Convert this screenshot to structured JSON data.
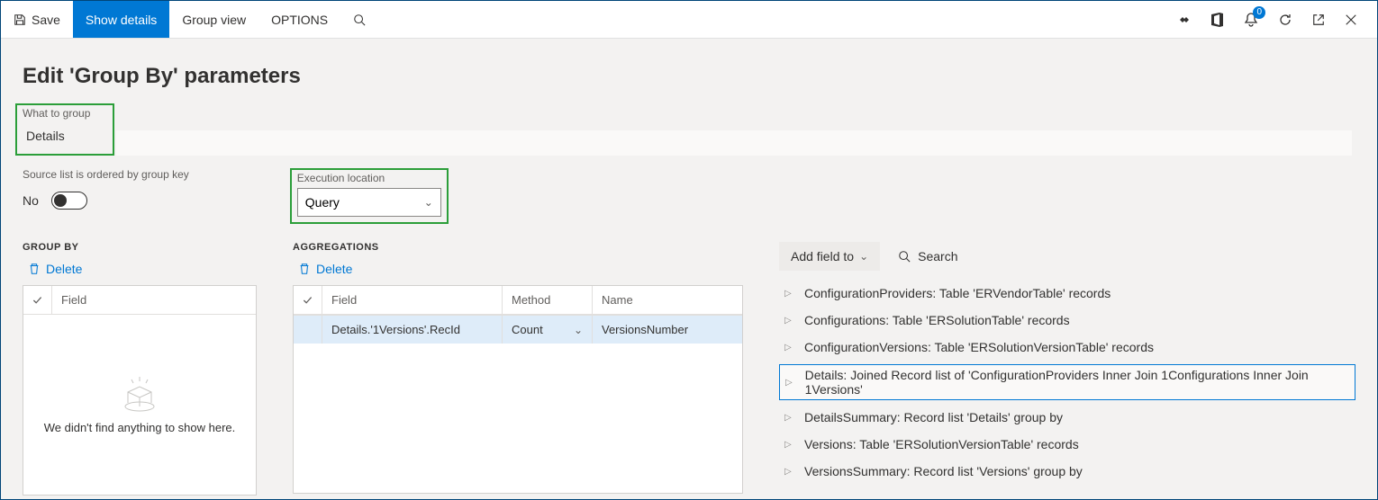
{
  "toolbar": {
    "save": "Save",
    "show_details": "Show details",
    "group_view": "Group view",
    "options": "OPTIONS",
    "badge_count": "0"
  },
  "page": {
    "title": "Edit 'Group By' parameters",
    "what_to_group_label": "What to group",
    "what_to_group_value": "Details",
    "ordered_label": "Source list is ordered by group key",
    "ordered_value": "No",
    "exec_label": "Execution location",
    "exec_value": "Query"
  },
  "groupby": {
    "heading": "GROUP BY",
    "delete": "Delete",
    "field_header": "Field",
    "empty_text": "We didn't find anything to show here."
  },
  "agg": {
    "heading": "AGGREGATIONS",
    "delete": "Delete",
    "field_header": "Field",
    "method_header": "Method",
    "name_header": "Name",
    "row": {
      "field": "Details.'1Versions'.RecId",
      "method": "Count",
      "name": "VersionsNumber"
    }
  },
  "tree": {
    "add_button": "Add field to",
    "search": "Search",
    "items": [
      "ConfigurationProviders: Table 'ERVendorTable' records",
      "Configurations: Table 'ERSolutionTable' records",
      "ConfigurationVersions: Table 'ERSolutionVersionTable' records",
      "Details: Joined Record list of 'ConfigurationProviders Inner Join 1Configurations Inner Join 1Versions'",
      "DetailsSummary: Record list 'Details' group by",
      "Versions: Table 'ERSolutionVersionTable' records",
      "VersionsSummary: Record list 'Versions' group by"
    ],
    "selected_index": 3
  }
}
